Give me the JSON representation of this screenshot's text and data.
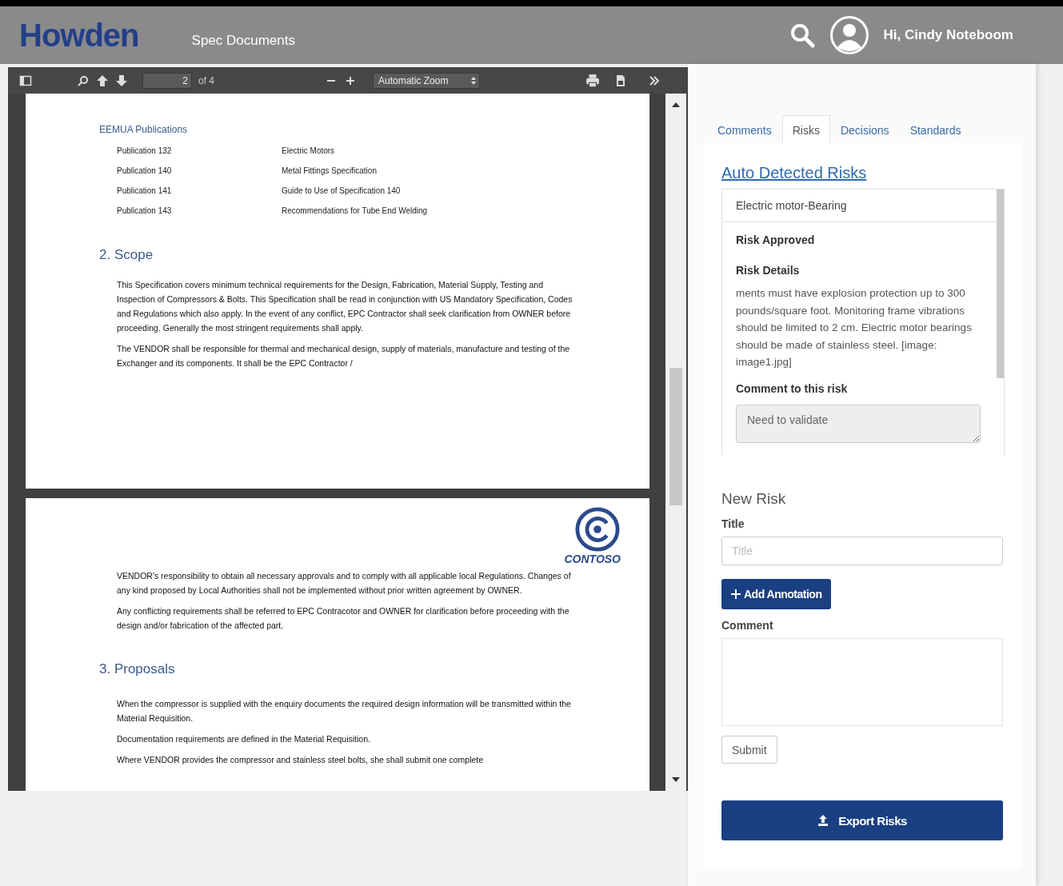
{
  "header": {
    "logo": "Howden",
    "section": "Spec Documents",
    "greeting": "Hi, Cindy Noteboom"
  },
  "viewer": {
    "toolbar": {
      "page_number": "2",
      "page_count": "of 4",
      "zoom": "Automatic Zoom"
    },
    "pages": [
      {
        "blocks": [
          {
            "kind": "subheading",
            "text": "EEMUA Publications"
          },
          {
            "kind": "table",
            "rows": [
              [
                "Publication 132",
                "Electric Motors"
              ],
              [
                "Publication 140",
                "Metal Fittings Specification"
              ],
              [
                "Publication 141",
                "Guide to Use of Specification 140"
              ],
              [
                "Publication 143",
                "Recommendations for Tube End Welding"
              ]
            ]
          },
          {
            "kind": "heading",
            "text": "2. Scope"
          },
          {
            "kind": "paragraph",
            "text": "This Specification covers minimum technical requirements for the Design, Fabrication, Material Supply, Testing and Inspection of Compressors & Bolts. This Specification shall be read in conjunction with US Mandatory Specification, Codes and Regulations which also apply. In the event of any conflict, EPC Contractor shall seek clarification from OWNER before proceeding. Generally the most stringent requirements shall apply."
          },
          {
            "kind": "paragraph",
            "text": "The VENDOR shall be responsible for thermal and mechanical design, supply of materials, manufacture and testing of the Exchanger and its components. It shall be the EPC Contractor /"
          }
        ]
      },
      {
        "blocks": [
          {
            "kind": "logo",
            "text": "CONTOSO"
          },
          {
            "kind": "paragraph",
            "text": "VENDOR's responsibility to obtain all necessary approvals and to comply with all applicable local Regulations. Changes of any kind proposed by Local Authorities shall not be implemented without prior written agreement by OWNER."
          },
          {
            "kind": "paragraph",
            "text": "Any conflicting requirements shall be referred to EPC Contracotor and OWNER for clarification before proceeding with the design and/or fabrication of the affected part."
          },
          {
            "kind": "heading",
            "text": "3. Proposals"
          },
          {
            "kind": "paragraph",
            "text": "When the compressor is supplied with the enquiry documents the required design information will be transmitted within the Material Requisition."
          },
          {
            "kind": "paragraph",
            "text": "Documentation requirements are defined in the Material Requisition."
          },
          {
            "kind": "paragraph",
            "text": "Where VENDOR provides the compressor and stainless steel bolts, she shall submit one complete"
          }
        ]
      }
    ]
  },
  "tabs": [
    {
      "label": "Comments",
      "selected": false
    },
    {
      "label": "Risks",
      "selected": true
    },
    {
      "label": "Decisions",
      "selected": false
    },
    {
      "label": "Standards",
      "selected": false
    }
  ],
  "risks": {
    "title": "Auto Detected Risks",
    "items": [
      {
        "name": "Electric motor-Bearing",
        "status": "Risk Approved",
        "details_label": "Risk Details",
        "details": "ments must have explosion protection up to 300 pounds/square foot. Monitoring frame vibrations should be limited to 2 cm. Electric motor bearings should be made of stainless steel. [image: image1.jpg]",
        "comment_label": "Comment to this risk",
        "comment": "Need to validate"
      }
    ]
  },
  "new_risk": {
    "heading": "New Risk",
    "title_label": "Title",
    "title_placeholder": "Title",
    "add_button": "Add Annotation",
    "comment_label": "Comment",
    "submit_button": "Submit"
  },
  "export_button": "Export Risks"
}
